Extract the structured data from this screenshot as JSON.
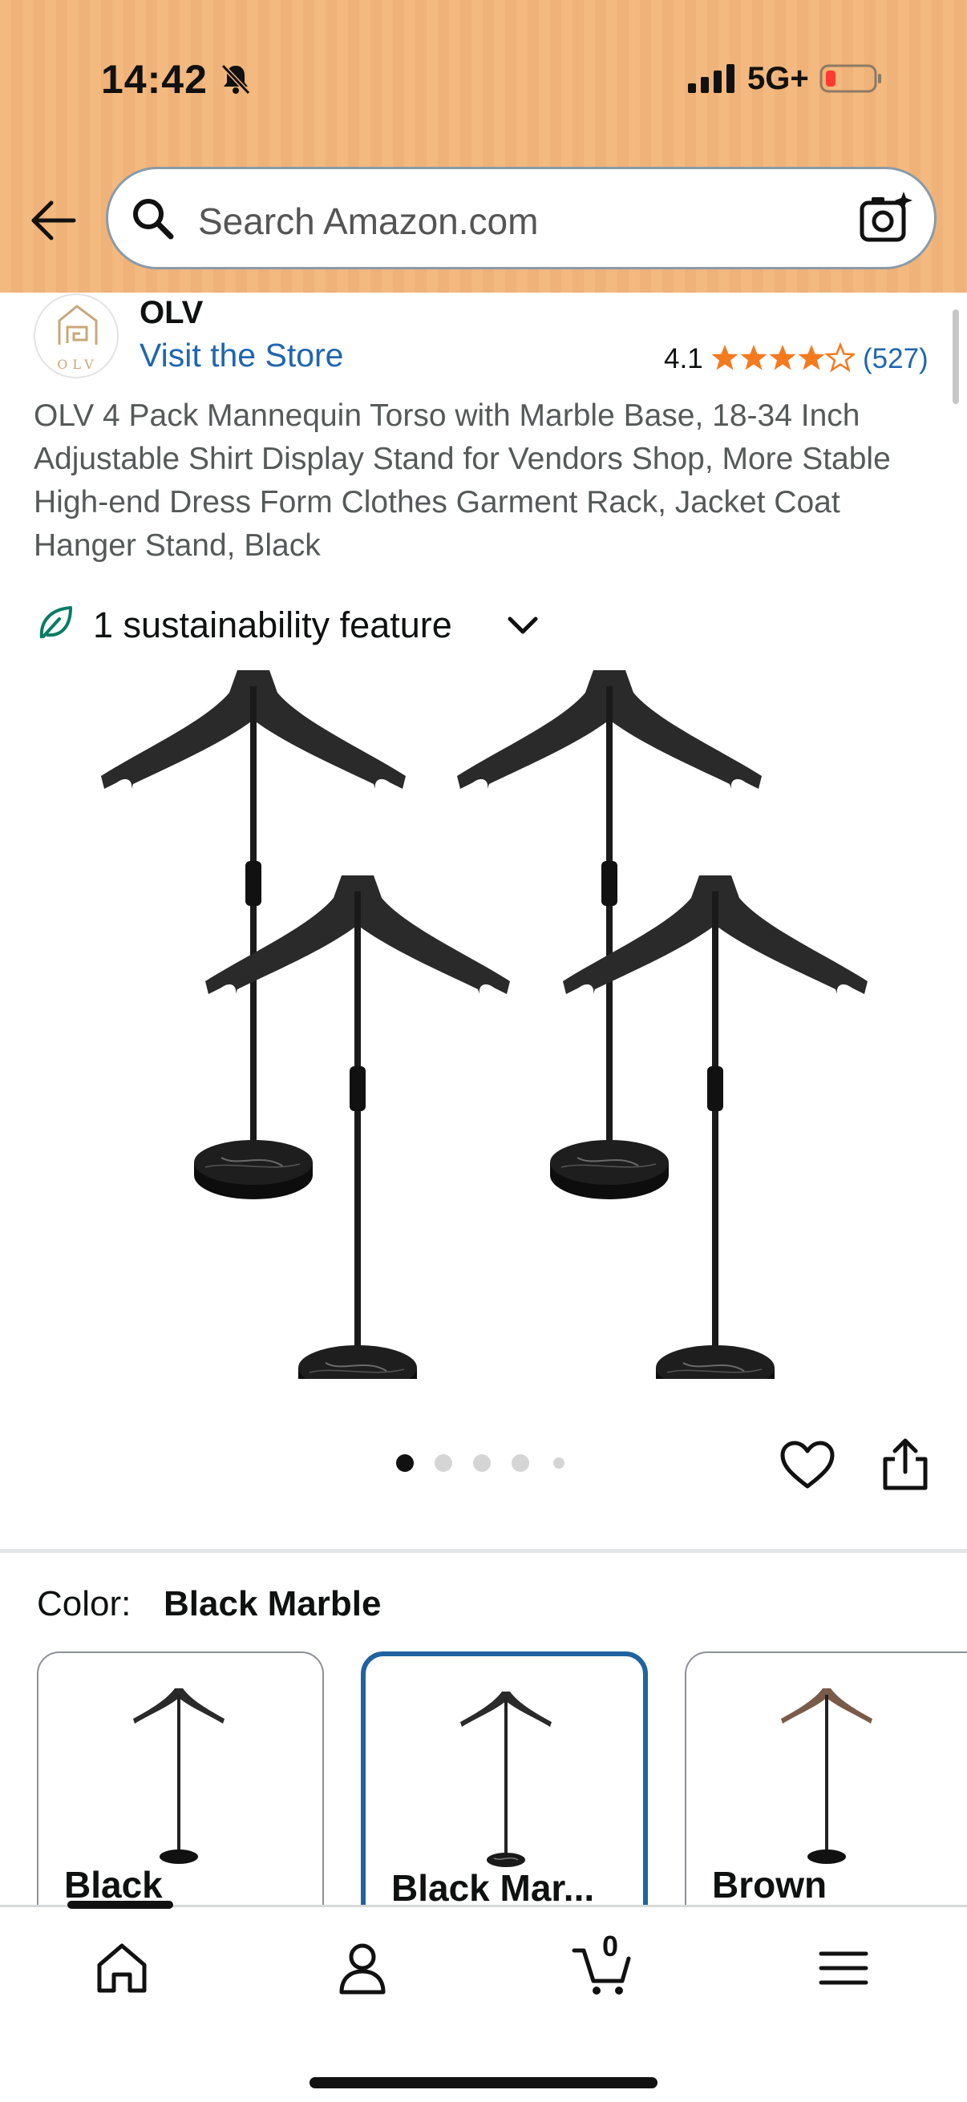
{
  "status_bar": {
    "time": "14:42",
    "network": "5G+"
  },
  "search": {
    "placeholder": "Search Amazon.com"
  },
  "brand": {
    "name": "OLV",
    "logo_text": "OLV",
    "visit_store": "Visit the Store",
    "rating": "4.1",
    "stars_filled": 4.1,
    "reviews": "(527)"
  },
  "product": {
    "title": "OLV 4 Pack Mannequin Torso with Marble Base, 18-34 Inch Adjustable Shirt Display Stand for Vendors Shop, More Stable High-end Dress Form Clothes Garment Rack, Jacket Coat Hanger Stand, Black",
    "sustainability": "1 sustainability feature",
    "image_count": 5,
    "active_image": 1
  },
  "color": {
    "label": "Color:",
    "selected": "Black Marble",
    "options": [
      {
        "label": "Black",
        "selected": false
      },
      {
        "label": "Black Mar...",
        "selected": true
      },
      {
        "label": "Brown",
        "selected": false
      }
    ]
  },
  "bottom_nav": {
    "cart_count": "0",
    "active_tab": "home"
  },
  "colors": {
    "header": "#f3b97f",
    "link": "#1f66b0",
    "star": "#f47a1f",
    "selected_border": "#2162a1",
    "leaf": "#067d62"
  }
}
